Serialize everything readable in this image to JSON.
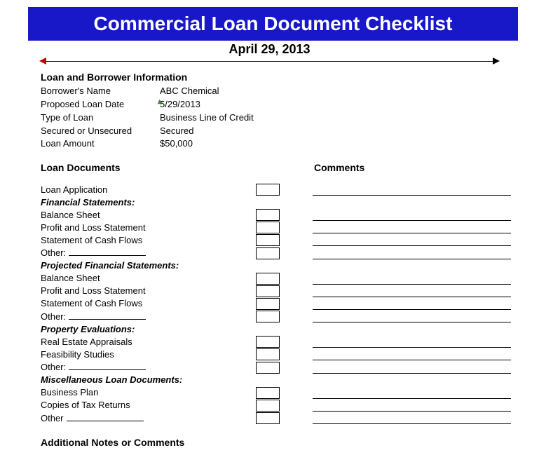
{
  "title": "Commercial Loan Document Checklist",
  "date": "April 29, 2013",
  "borrower_section": {
    "heading": "Loan and Borrower Information",
    "fields": [
      {
        "label": "Borrower's Name",
        "value": "ABC Chemical",
        "flag": false
      },
      {
        "label": "Proposed Loan Date",
        "value": "5/29/2013",
        "flag": true
      },
      {
        "label": "Type of Loan",
        "value": "Business Line of Credit",
        "flag": false
      },
      {
        "label": "Secured or Unsecured",
        "value": "Secured",
        "flag": false
      },
      {
        "label": "Loan Amount",
        "value": "$50,000",
        "flag": false
      }
    ]
  },
  "docs_heading": "Loan Documents",
  "comments_heading": "Comments",
  "rows": [
    {
      "label": "Loan Application",
      "type": "item"
    },
    {
      "label": "Financial Statements:",
      "type": "subhead"
    },
    {
      "label": "Balance Sheet",
      "type": "item"
    },
    {
      "label": "Profit and Loss Statement",
      "type": "item"
    },
    {
      "label": "Statement of Cash Flows",
      "type": "item"
    },
    {
      "label": "Other:",
      "type": "other"
    },
    {
      "label": "Projected Financial Statements:",
      "type": "subhead"
    },
    {
      "label": "Balance Sheet",
      "type": "item"
    },
    {
      "label": "Profit and Loss Statement",
      "type": "item"
    },
    {
      "label": "Statement of Cash Flows",
      "type": "item"
    },
    {
      "label": "Other:",
      "type": "other"
    },
    {
      "label": "Property Evaluations:",
      "type": "subhead"
    },
    {
      "label": "Real Estate Appraisals",
      "type": "item"
    },
    {
      "label": "Feasibility Studies",
      "type": "item"
    },
    {
      "label": "Other:",
      "type": "other"
    },
    {
      "label": "Miscellaneous Loan Documents:",
      "type": "subhead"
    },
    {
      "label": "Business Plan",
      "type": "item"
    },
    {
      "label": "Copies of Tax Returns",
      "type": "item"
    },
    {
      "label": "Other",
      "type": "other"
    }
  ],
  "notes_heading": "Additional Notes or Comments"
}
